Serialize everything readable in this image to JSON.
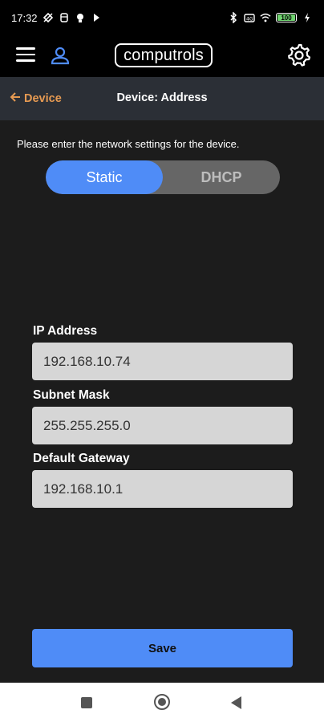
{
  "status_bar": {
    "time": "17:32",
    "battery_label": "100"
  },
  "header": {
    "logo_text": "computrols"
  },
  "nav": {
    "back_label": "Device",
    "title": "Device: Address"
  },
  "form": {
    "instructions": "Please enter the network settings for the device.",
    "mode_options": [
      "Static",
      "DHCP"
    ],
    "selected_mode": "Static",
    "fields": [
      {
        "label": "IP Address",
        "value": "192.168.10.74"
      },
      {
        "label": "Subnet Mask",
        "value": "255.255.255.0"
      },
      {
        "label": "Default Gateway",
        "value": "192.168.10.1"
      }
    ],
    "save_label": "Save"
  },
  "colors": {
    "accent": "#4f8cf7",
    "back_link": "#e69a52",
    "background": "#1c1c1c",
    "nav_bar": "#2b2f36"
  }
}
